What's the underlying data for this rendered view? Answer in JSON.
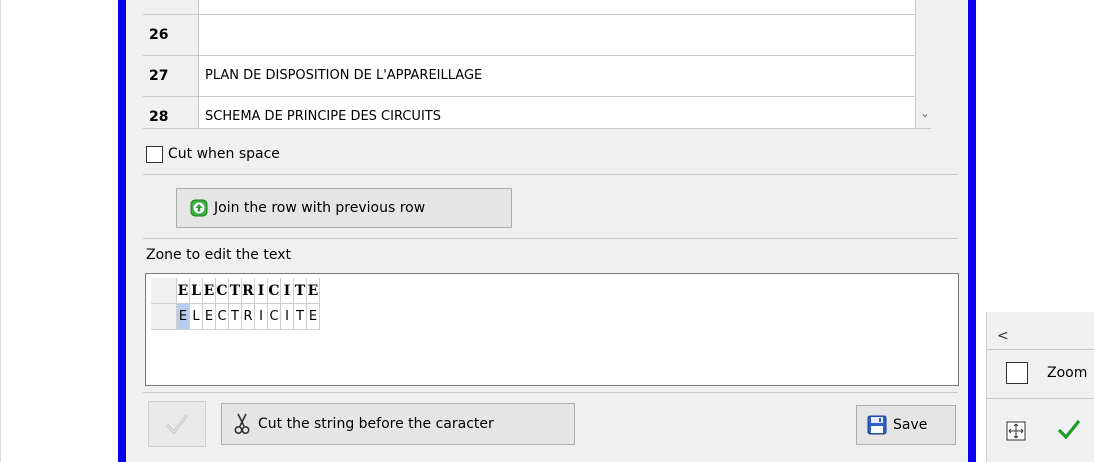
{
  "table": {
    "rows": [
      {
        "num": "",
        "text": ""
      },
      {
        "num": "26",
        "text": ""
      },
      {
        "num": "27",
        "text": "PLAN DE DISPOSITION DE L'APPAREILLAGE"
      },
      {
        "num": "28",
        "text": "SCHEMA DE PRINCIPE DES CIRCUITS"
      }
    ]
  },
  "options": {
    "cut_when_space_label": "Cut when space",
    "cut_when_space_checked": false
  },
  "buttons": {
    "join_row_label": "Join the row with previous row",
    "cut_string_label": "Cut the string before the caracter",
    "save_label": "Save"
  },
  "edit_zone": {
    "label": "Zone to edit the text",
    "header_chars": [
      "E",
      "L",
      "E",
      "C",
      "T",
      "R",
      "I",
      "C",
      "I",
      "T",
      "E"
    ],
    "value_chars": [
      "E",
      "L",
      "E",
      "C",
      "T",
      "R",
      "I",
      "C",
      "I",
      "T",
      "E"
    ],
    "selected_index": 0
  },
  "side_panel": {
    "scroll_left_glyph": "<",
    "zoom_label": "Zoom"
  },
  "icons": {
    "join": "green-up-arrow-icon",
    "cut": "scissors-icon",
    "save": "floppy-disk-icon",
    "confirm": "checkmark-icon",
    "fit": "fit-to-window-icon"
  }
}
